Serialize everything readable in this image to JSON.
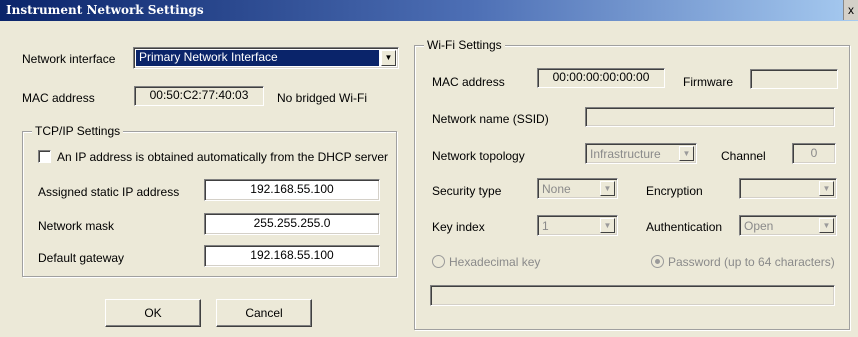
{
  "window": {
    "title": "Instrument Network Settings",
    "close_label": "x"
  },
  "network": {
    "interface_label": "Network interface",
    "interface_value": "Primary Network Interface",
    "mac_label": "MAC address",
    "mac_value": "00:50:C2:77:40:03",
    "bridged_note": "No bridged Wi-Fi"
  },
  "tcpip": {
    "group_label": "TCP/IP Settings",
    "dhcp_label": "An IP address is obtained automatically from the DHCP server",
    "dhcp_checked": false,
    "ip_label": "Assigned static IP address",
    "ip_value": "192.168.55.100",
    "mask_label": "Network mask",
    "mask_value": "255.255.255.0",
    "gateway_label": "Default gateway",
    "gateway_value": "192.168.55.100"
  },
  "buttons": {
    "ok": "OK",
    "cancel": "Cancel"
  },
  "wifi": {
    "group_label": "Wi-Fi Settings",
    "mac_label": "MAC address",
    "mac_value": "00:00:00:00:00:00",
    "firmware_label": "Firmware",
    "firmware_value": "",
    "ssid_label": "Network name (SSID)",
    "ssid_value": "",
    "topology_label": "Network topology",
    "topology_value": "Infrastructure",
    "channel_label": "Channel",
    "channel_value": "0",
    "security_label": "Security type",
    "security_value": "None",
    "encryption_label": "Encryption",
    "encryption_value": "",
    "key_index_label": "Key index",
    "key_index_value": "1",
    "auth_label": "Authentication",
    "auth_value": "Open",
    "hex_key_label": "Hexadecimal key",
    "password_label": "Password (up to 64 characters)",
    "password_value": ""
  },
  "icons": {
    "dropdown": "chevron-down-icon",
    "close": "close-icon"
  },
  "colors": {
    "titlebar_start": "#0a246a",
    "titlebar_end": "#a6caf0",
    "dialog_bg": "#ece9d8",
    "selection": "#0a246a"
  }
}
